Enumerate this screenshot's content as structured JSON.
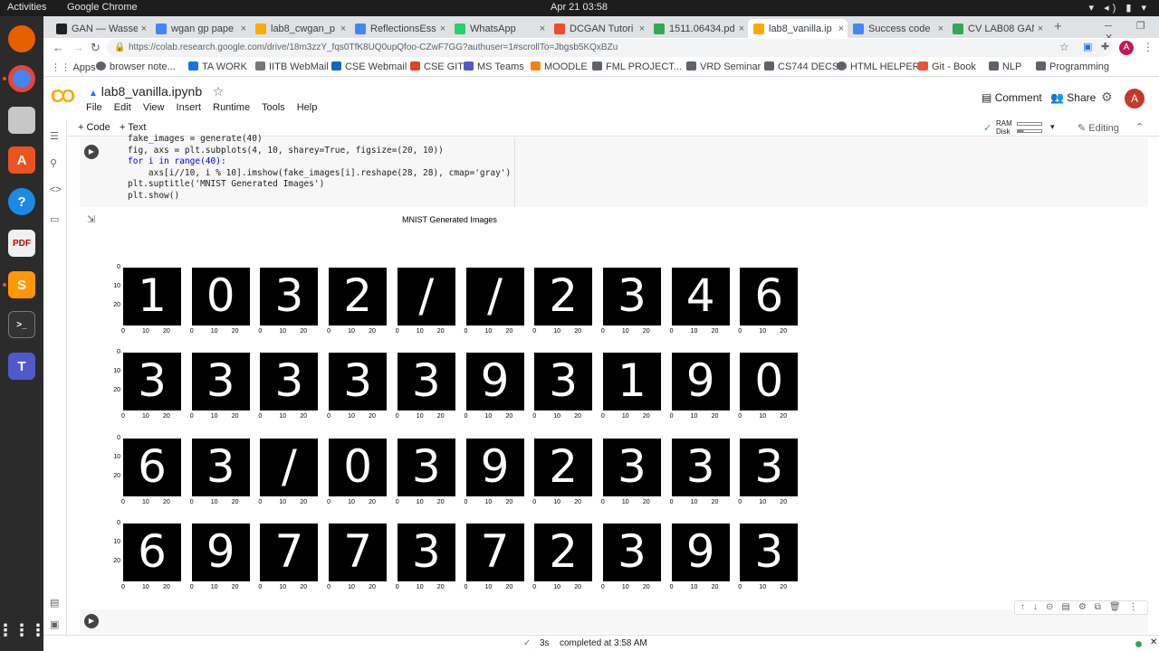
{
  "system_bar": {
    "activities": "Activities",
    "app_name": "Google Chrome",
    "clock": "Apr 21  03:58"
  },
  "tabs": [
    {
      "title": "GAN — Wasse",
      "color": "#202124"
    },
    {
      "title": "wgan gp pape",
      "color": "#4285f4"
    },
    {
      "title": "lab8_cwgan_p",
      "color": "#f9ab00"
    },
    {
      "title": "ReflectionsEss",
      "color": "#4285f4"
    },
    {
      "title": "WhatsApp",
      "color": "#25d366"
    },
    {
      "title": "DCGAN Tutori",
      "color": "#ee4c2c"
    },
    {
      "title": "1511.06434.pd",
      "color": "#34a853"
    },
    {
      "title": "lab8_vanilla.ip",
      "color": "#f9ab00"
    },
    {
      "title": "Success code",
      "color": "#4285f4"
    },
    {
      "title": "CV LAB08 GAN",
      "color": "#34a853"
    }
  ],
  "url": "https://colab.research.google.com/drive/18m3zzY_fqs0TfK8UQ0upQfoo-CZwF7GG?authuser=1#scrollTo=Jbgsb5KQxBZu",
  "bookmarks": [
    "Apps",
    "browser note...",
    "TA WORK",
    "IITB WebMail",
    "CSE Webmail",
    "CSE GIT",
    "MS Teams",
    "MOODLE",
    "FML PROJECT...",
    "VRD Seminar",
    "CS744 DECS",
    "HTML HELPER",
    "Git - Book",
    "NLP",
    "Programming"
  ],
  "colab": {
    "logo": "CO",
    "title": "lab8_vanilla.ipynb",
    "menus": [
      "File",
      "Edit",
      "View",
      "Insert",
      "Runtime",
      "Tools",
      "Help"
    ],
    "comment": "Comment",
    "share": "Share",
    "avatar": "A",
    "add_code": "+ Code",
    "add_text": "+ Text",
    "ram": "RAM",
    "disk": "Disk",
    "editing": "Editing"
  },
  "code_lines": [
    "fake_images = generate(40)",
    "fig, axs = plt.subplots(4, 10, sharey=True, figsize=(20, 10))",
    "for i in range(40):",
    "    axs[i//10, i % 10].imshow(fake_images[i].reshape(28, 28), cmap='gray')",
    "plt.suptitle('MNIST Generated Images')",
    "plt.show()"
  ],
  "figure": {
    "suptitle": "MNIST Generated Images",
    "yticks": [
      "0",
      "10",
      "20"
    ],
    "xticks": [
      "0",
      "10",
      "20"
    ],
    "digits": [
      [
        "1",
        "0",
        "3",
        "2",
        "/",
        "/",
        "2",
        "3",
        "4",
        "6"
      ],
      [
        "3",
        "3",
        "3",
        "3",
        "3",
        "9",
        "3",
        "1",
        "9",
        "0"
      ],
      [
        "6",
        "3",
        "/",
        "0",
        "3",
        "9",
        "2",
        "3",
        "3",
        "3"
      ],
      [
        "6",
        "9",
        "7",
        "7",
        "3",
        "7",
        "2",
        "3",
        "9",
        "3"
      ]
    ]
  },
  "status": {
    "time": "3s",
    "message": "completed at 3:58 AM"
  }
}
